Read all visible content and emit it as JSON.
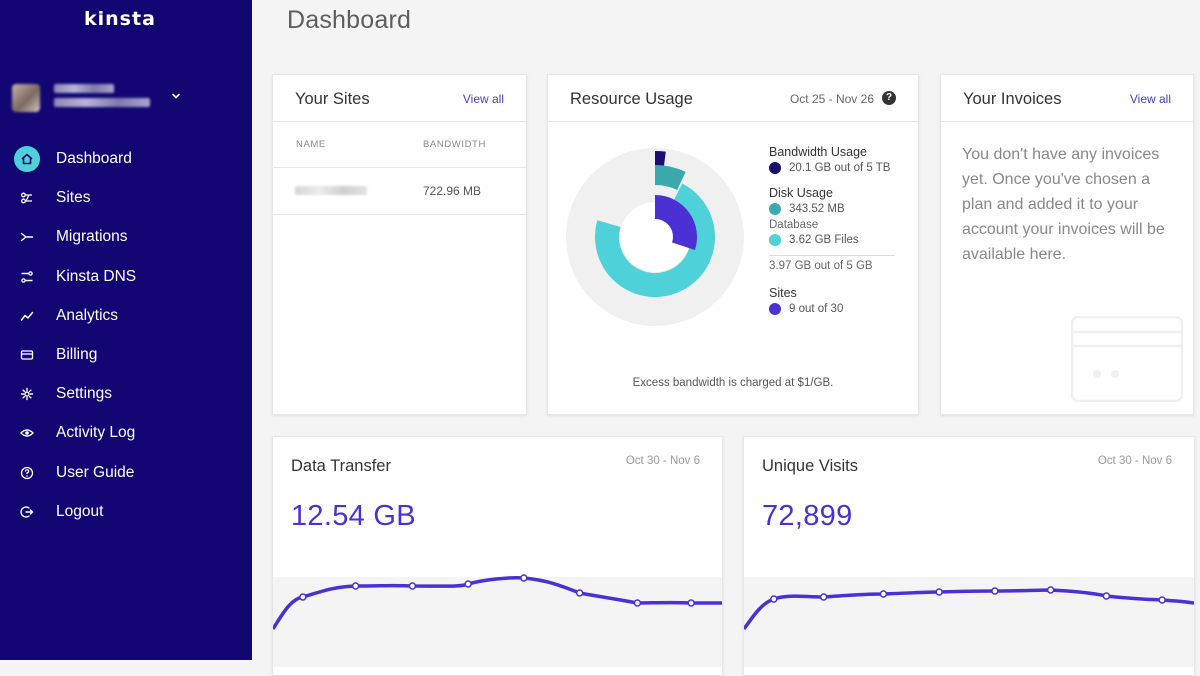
{
  "sidebar": {
    "brand": "kinsta",
    "items": [
      {
        "label": "Dashboard",
        "icon": "home-icon",
        "active": true
      },
      {
        "label": "Sites",
        "icon": "sites-icon"
      },
      {
        "label": "Migrations",
        "icon": "migrations-icon"
      },
      {
        "label": "Kinsta DNS",
        "icon": "dns-icon"
      },
      {
        "label": "Analytics",
        "icon": "analytics-icon"
      },
      {
        "label": "Billing",
        "icon": "billing-icon"
      },
      {
        "label": "Settings",
        "icon": "gear-icon"
      },
      {
        "label": "Activity Log",
        "icon": "eye-icon"
      },
      {
        "label": "User Guide",
        "icon": "help-circle-icon"
      },
      {
        "label": "Logout",
        "icon": "logout-icon"
      }
    ]
  },
  "page": {
    "title": "Dashboard"
  },
  "sites_card": {
    "title": "Your Sites",
    "view_all": "View all",
    "columns": [
      "NAME",
      "BANDWIDTH"
    ],
    "rows": [
      {
        "bandwidth": "722.96 MB"
      }
    ]
  },
  "resource_card": {
    "title": "Resource Usage",
    "date_range": "Oct 25 - Nov 26",
    "help": "?",
    "bandwidth": {
      "title": "Bandwidth Usage",
      "value": "20.1 GB out of 5 TB"
    },
    "disk": {
      "title": "Disk Usage",
      "database": "343.52 MB",
      "database_label": "Database",
      "files": "3.62 GB Files",
      "total": "3.97 GB out of 5 GB"
    },
    "sites": {
      "title": "Sites",
      "value": "9 out of 30"
    },
    "note": "Excess bandwidth is charged at $1/GB."
  },
  "invoices_card": {
    "title": "Your Invoices",
    "view_all": "View all",
    "empty_text": "You don't have any invoices yet. Once you've chosen a plan and added it to your account your invoices will be available here."
  },
  "data_transfer": {
    "title": "Data Transfer",
    "date_range": "Oct 30 - Nov 6",
    "value": "12.54 GB"
  },
  "unique_visits": {
    "title": "Unique Visits",
    "date_range": "Oct 30 - Nov 6",
    "value": "72,899"
  },
  "colors": {
    "sidebar_bg": "#120673",
    "accent": "#4b30d4",
    "active_icon_bg": "#4fd1d9",
    "bandwidth": "#1a0f6e",
    "database": "#3aa8ad",
    "files": "#4fd1d9",
    "sites": "#4b30d4"
  },
  "usage_fractions": {
    "bandwidth": 0.02,
    "database": 0.07,
    "files": 0.72,
    "sites": 0.3
  }
}
